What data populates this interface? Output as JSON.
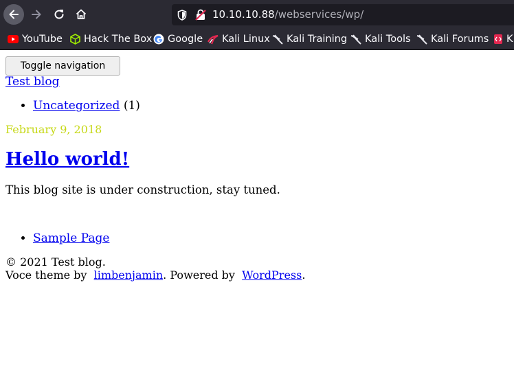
{
  "browser": {
    "url_host": "10.10.10.88",
    "url_path": "/webservices/wp/",
    "bookmarks": [
      {
        "label": "YouTube",
        "icon": "youtube-icon"
      },
      {
        "label": "Hack The Box",
        "icon": "hackthebox-icon"
      },
      {
        "label": "Google",
        "icon": "google-icon"
      },
      {
        "label": "Kali Linux",
        "icon": "kali-icon"
      },
      {
        "label": "Kali Training",
        "icon": "kali-icon"
      },
      {
        "label": "Kali Tools",
        "icon": "kali-icon"
      },
      {
        "label": "Kali Forums",
        "icon": "kali-icon"
      },
      {
        "label": "K",
        "icon": "exploit-icon"
      }
    ]
  },
  "page": {
    "toggle_label": "Toggle navigation",
    "blog_title": "Test blog",
    "categories": [
      {
        "name": "Uncategorized",
        "count": "(1)"
      }
    ],
    "post": {
      "date": "February 9, 2018",
      "title": "Hello world!",
      "body": "This blog site is under construction, stay tuned."
    },
    "pages": [
      {
        "name": "Sample Page"
      }
    ],
    "footer": {
      "copyright": "© 2021 Test blog.",
      "theme_prefix": "Voce theme by ",
      "theme_author": "limbenjamin",
      "powered_prefix": ". Powered by ",
      "powered_link": "WordPress",
      "end": "."
    }
  }
}
